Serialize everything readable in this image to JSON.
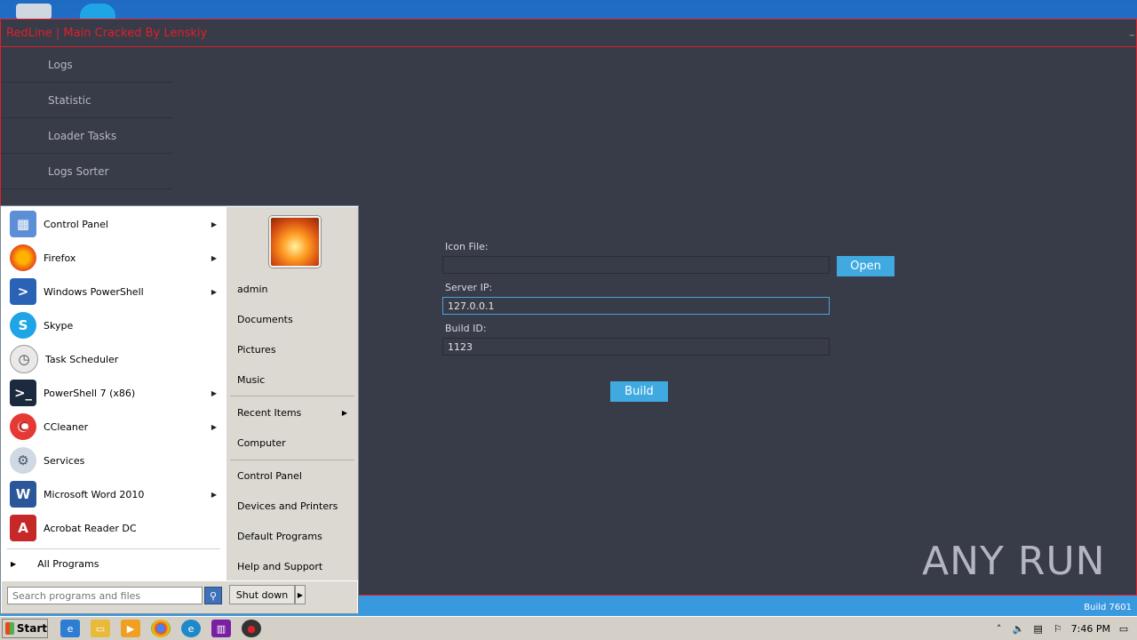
{
  "app": {
    "title": "RedLine | Main Cracked By Lenskiy",
    "nav": [
      "Logs",
      "Statistic",
      "Loader Tasks",
      "Logs Sorter"
    ],
    "form": {
      "icon_label": "Icon File:",
      "icon_value": "",
      "open_button": "Open",
      "server_label": "Server IP:",
      "server_value": "127.0.0.1",
      "build_id_label": "Build ID:",
      "build_id_value": "1123",
      "build_button": "Build"
    },
    "accent_color": "#e0202a",
    "button_color": "#3fa9e0"
  },
  "watermark": {
    "text": "ANY RUN"
  },
  "windows_build": {
    "line": "Build 7601"
  },
  "start_menu": {
    "programs": [
      {
        "label": "Control Panel",
        "icon": "control-panel-icon",
        "submenu": true
      },
      {
        "label": "Firefox",
        "icon": "firefox-icon",
        "submenu": true
      },
      {
        "label": "Windows PowerShell",
        "icon": "powershell-icon",
        "submenu": true
      },
      {
        "label": "Skype",
        "icon": "skype-icon",
        "submenu": false
      },
      {
        "label": "Task Scheduler",
        "icon": "task-scheduler-icon",
        "submenu": false
      },
      {
        "label": "PowerShell 7 (x86)",
        "icon": "powershell7-icon",
        "submenu": true
      },
      {
        "label": "CCleaner",
        "icon": "ccleaner-icon",
        "submenu": true
      },
      {
        "label": "Services",
        "icon": "services-icon",
        "submenu": false
      },
      {
        "label": "Microsoft Word 2010",
        "icon": "word-icon",
        "submenu": true
      },
      {
        "label": "Acrobat Reader DC",
        "icon": "acrobat-icon",
        "submenu": false
      }
    ],
    "all_programs": "All Programs",
    "right_items": {
      "user": "admin",
      "documents": "Documents",
      "pictures": "Pictures",
      "music": "Music",
      "recent": "Recent Items",
      "computer": "Computer",
      "control_panel": "Control Panel",
      "devices": "Devices and Printers",
      "defaults": "Default Programs",
      "help": "Help and Support"
    },
    "search_placeholder": "Search programs and files",
    "shutdown": "Shut down"
  },
  "taskbar": {
    "start": "Start",
    "clock": "7:46 PM"
  }
}
